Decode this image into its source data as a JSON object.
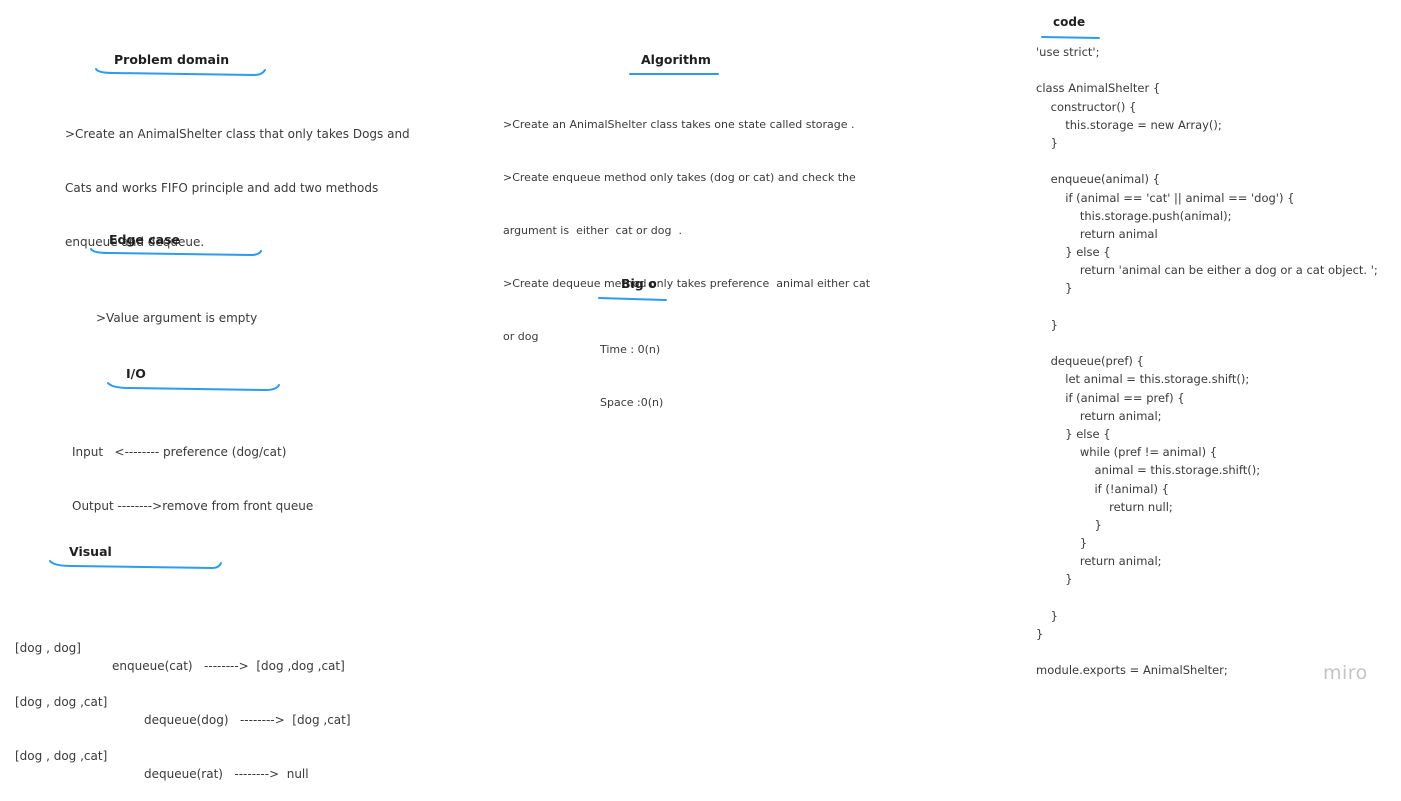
{
  "problem_domain": {
    "heading": "Problem domain",
    "lines": [
      ">Create an AnimalShelter class that only takes Dogs and",
      "Cats and works FIFO principle and add two methods",
      "enqueue and dequeue."
    ]
  },
  "algorithm": {
    "heading": "Algorithm",
    "lines": [
      ">Create an AnimalShelter class takes one state called storage .",
      ">Create enqueue method only takes (dog or cat) and check the",
      "argument is  either  cat or dog  .",
      ">Create dequeue method only takes preference  animal either cat",
      "or dog"
    ]
  },
  "edge_case": {
    "heading": "Edge case",
    "lines": [
      ">Value argument is empty"
    ]
  },
  "big_o": {
    "heading": "Big o",
    "lines": [
      "Time : 0(n)",
      "Space :0(n)"
    ]
  },
  "io": {
    "heading": "I/O",
    "lines": [
      "Input   <-------- preference (dog/cat)",
      "Output -------->remove from front queue"
    ]
  },
  "visual": {
    "heading": "Visual",
    "rows": [
      [
        "[dog , dog]",
        "enqueue(cat)   -------->  [dog ,dog ,cat]"
      ],
      [
        "[dog , dog ,cat]",
        "dequeue(dog)   -------->  [dog ,cat]"
      ],
      [
        "[dog , dog ,cat]",
        "dequeue(rat)   -------->  null"
      ]
    ]
  },
  "code": {
    "heading": "code",
    "lines": [
      "'use strict';",
      "",
      "class AnimalShelter {",
      "    constructor() {",
      "        this.storage = new Array();",
      "    }",
      "",
      "    enqueue(animal) {",
      "        if (animal == 'cat' || animal == 'dog') {",
      "            this.storage.push(animal);",
      "            return animal",
      "        } else {",
      "            return 'animal can be either a dog or a cat object. ';",
      "        }",
      "",
      "    }",
      "",
      "    dequeue(pref) {",
      "        let animal = this.storage.shift();",
      "        if (animal == pref) {",
      "            return animal;",
      "        } else {",
      "            while (pref != animal) {",
      "                animal = this.storage.shift();",
      "                if (!animal) {",
      "                    return null;",
      "                }",
      "            }",
      "            return animal;",
      "        }",
      "",
      "    }",
      "}",
      "",
      "module.exports = AnimalShelter;"
    ]
  },
  "branding": {
    "logo_text": "miro"
  },
  "colors": {
    "underline": "#2d9bf0",
    "text": "#3a3a3a",
    "heading": "#1f1f1f"
  }
}
